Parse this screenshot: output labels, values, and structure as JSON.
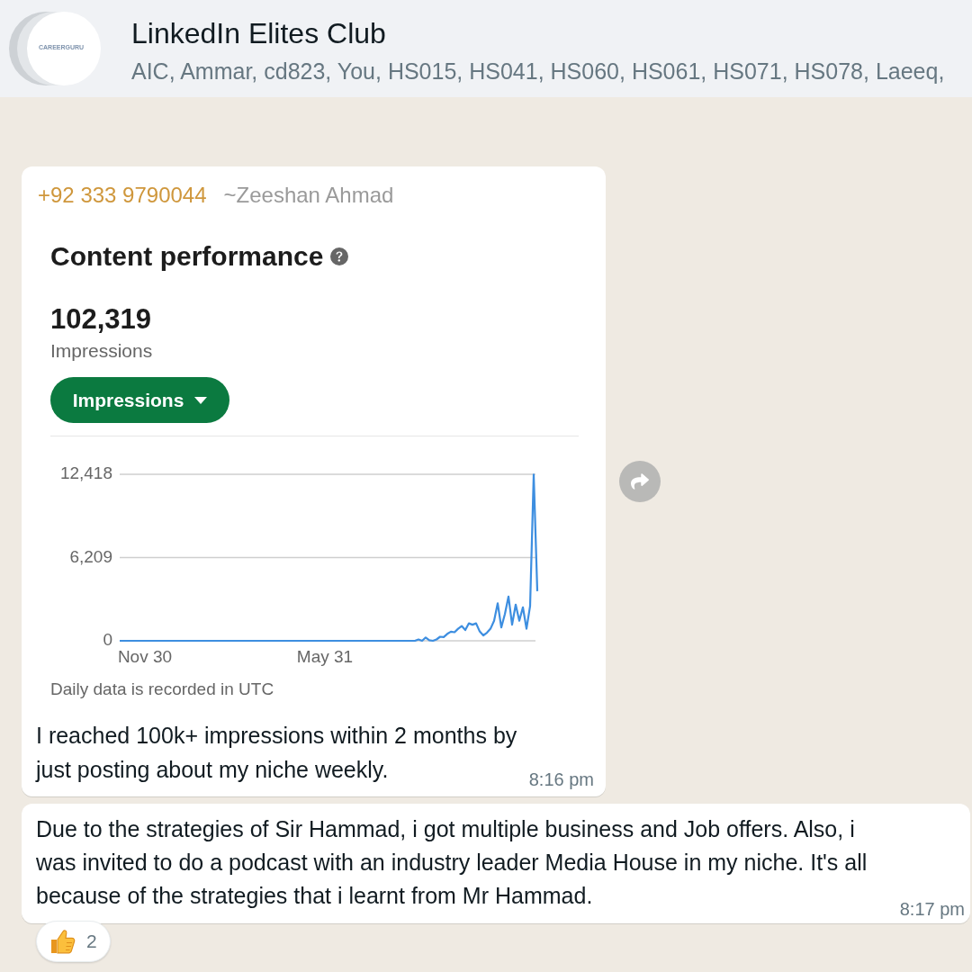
{
  "header": {
    "avatar_logo": "CAREERGURU",
    "title": "LinkedIn Elites Club",
    "members": "AIC, Ammar, cd823, You, HS015, HS041, HS060, HS061, HS071, HS078, Laeeq,"
  },
  "messages": [
    {
      "kind": "image",
      "sender_phone": "+92 333 9790044",
      "sender_name": "~Zeeshan Ahmad",
      "screenshot": {
        "heading": "Content performance",
        "total": "102,319",
        "total_label": "Impressions",
        "metric_dropdown": "Impressions",
        "chart_data": {
          "type": "line",
          "ylim": [
            0,
            12418
          ],
          "yticks": [
            {
              "value": 0,
              "label": "0"
            },
            {
              "value": 6209,
              "label": "6,209"
            },
            {
              "value": 12418,
              "label": "12,418"
            }
          ],
          "categories": [
            null,
            null,
            null,
            null,
            null,
            null,
            null,
            "Nov 30",
            null,
            null,
            null,
            null,
            null,
            null,
            null,
            null,
            null,
            null,
            null,
            null,
            null,
            null,
            null,
            null,
            null,
            null,
            null,
            null,
            null,
            null,
            null,
            null,
            null,
            null,
            null,
            null,
            null,
            null,
            null,
            null,
            null,
            null,
            null,
            null,
            null,
            null,
            null,
            null,
            null,
            null,
            null,
            null,
            null,
            null,
            null,
            null,
            null,
            "May 31",
            null,
            null,
            null,
            null,
            null,
            null,
            null,
            null,
            null,
            null,
            null,
            null,
            null,
            null,
            null,
            null,
            null,
            null,
            null,
            null,
            null,
            null,
            null,
            null,
            null,
            null,
            null,
            null,
            null,
            null,
            null,
            null,
            null,
            null,
            null,
            null,
            null,
            null,
            null,
            null,
            null,
            null,
            null,
            null,
            null,
            null,
            null,
            null,
            null,
            null,
            null,
            null,
            null,
            null,
            null,
            null,
            null,
            null,
            null
          ],
          "values": [
            0,
            0,
            0,
            0,
            0,
            0,
            0,
            0,
            0,
            0,
            0,
            0,
            0,
            0,
            0,
            0,
            0,
            0,
            0,
            0,
            0,
            0,
            0,
            0,
            0,
            0,
            0,
            0,
            0,
            0,
            0,
            0,
            0,
            0,
            0,
            0,
            0,
            0,
            0,
            0,
            0,
            0,
            0,
            0,
            0,
            0,
            0,
            0,
            0,
            0,
            0,
            0,
            0,
            0,
            0,
            0,
            0,
            0,
            0,
            0,
            0,
            0,
            0,
            0,
            0,
            0,
            0,
            0,
            0,
            0,
            0,
            0,
            0,
            0,
            0,
            0,
            0,
            0,
            0,
            0,
            0,
            0,
            0,
            100,
            0,
            250,
            50,
            0,
            100,
            300,
            280,
            520,
            680,
            640,
            900,
            1100,
            800,
            1300,
            1200,
            1300,
            700,
            400,
            600,
            900,
            1500,
            2800,
            1000,
            2000,
            3300,
            1200,
            2700,
            1500,
            2500,
            900,
            2600,
            12400,
            3700
          ]
        },
        "footnote": "Daily data is recorded in UTC"
      },
      "text": "I reached 100k+ impressions within 2 months by just posting about my niche weekly.",
      "time": "8:16 pm"
    },
    {
      "kind": "text",
      "text": "Due to the strategies of Sir Hammad, i got multiple business and Job offers. Also, i was invited to do a podcast with an industry leader Media House in my niche. It's all because of the strategies that i learnt from Mr Hammad.",
      "time": "8:17 pm",
      "reactions": [
        {
          "count": "2"
        }
      ]
    }
  ]
}
